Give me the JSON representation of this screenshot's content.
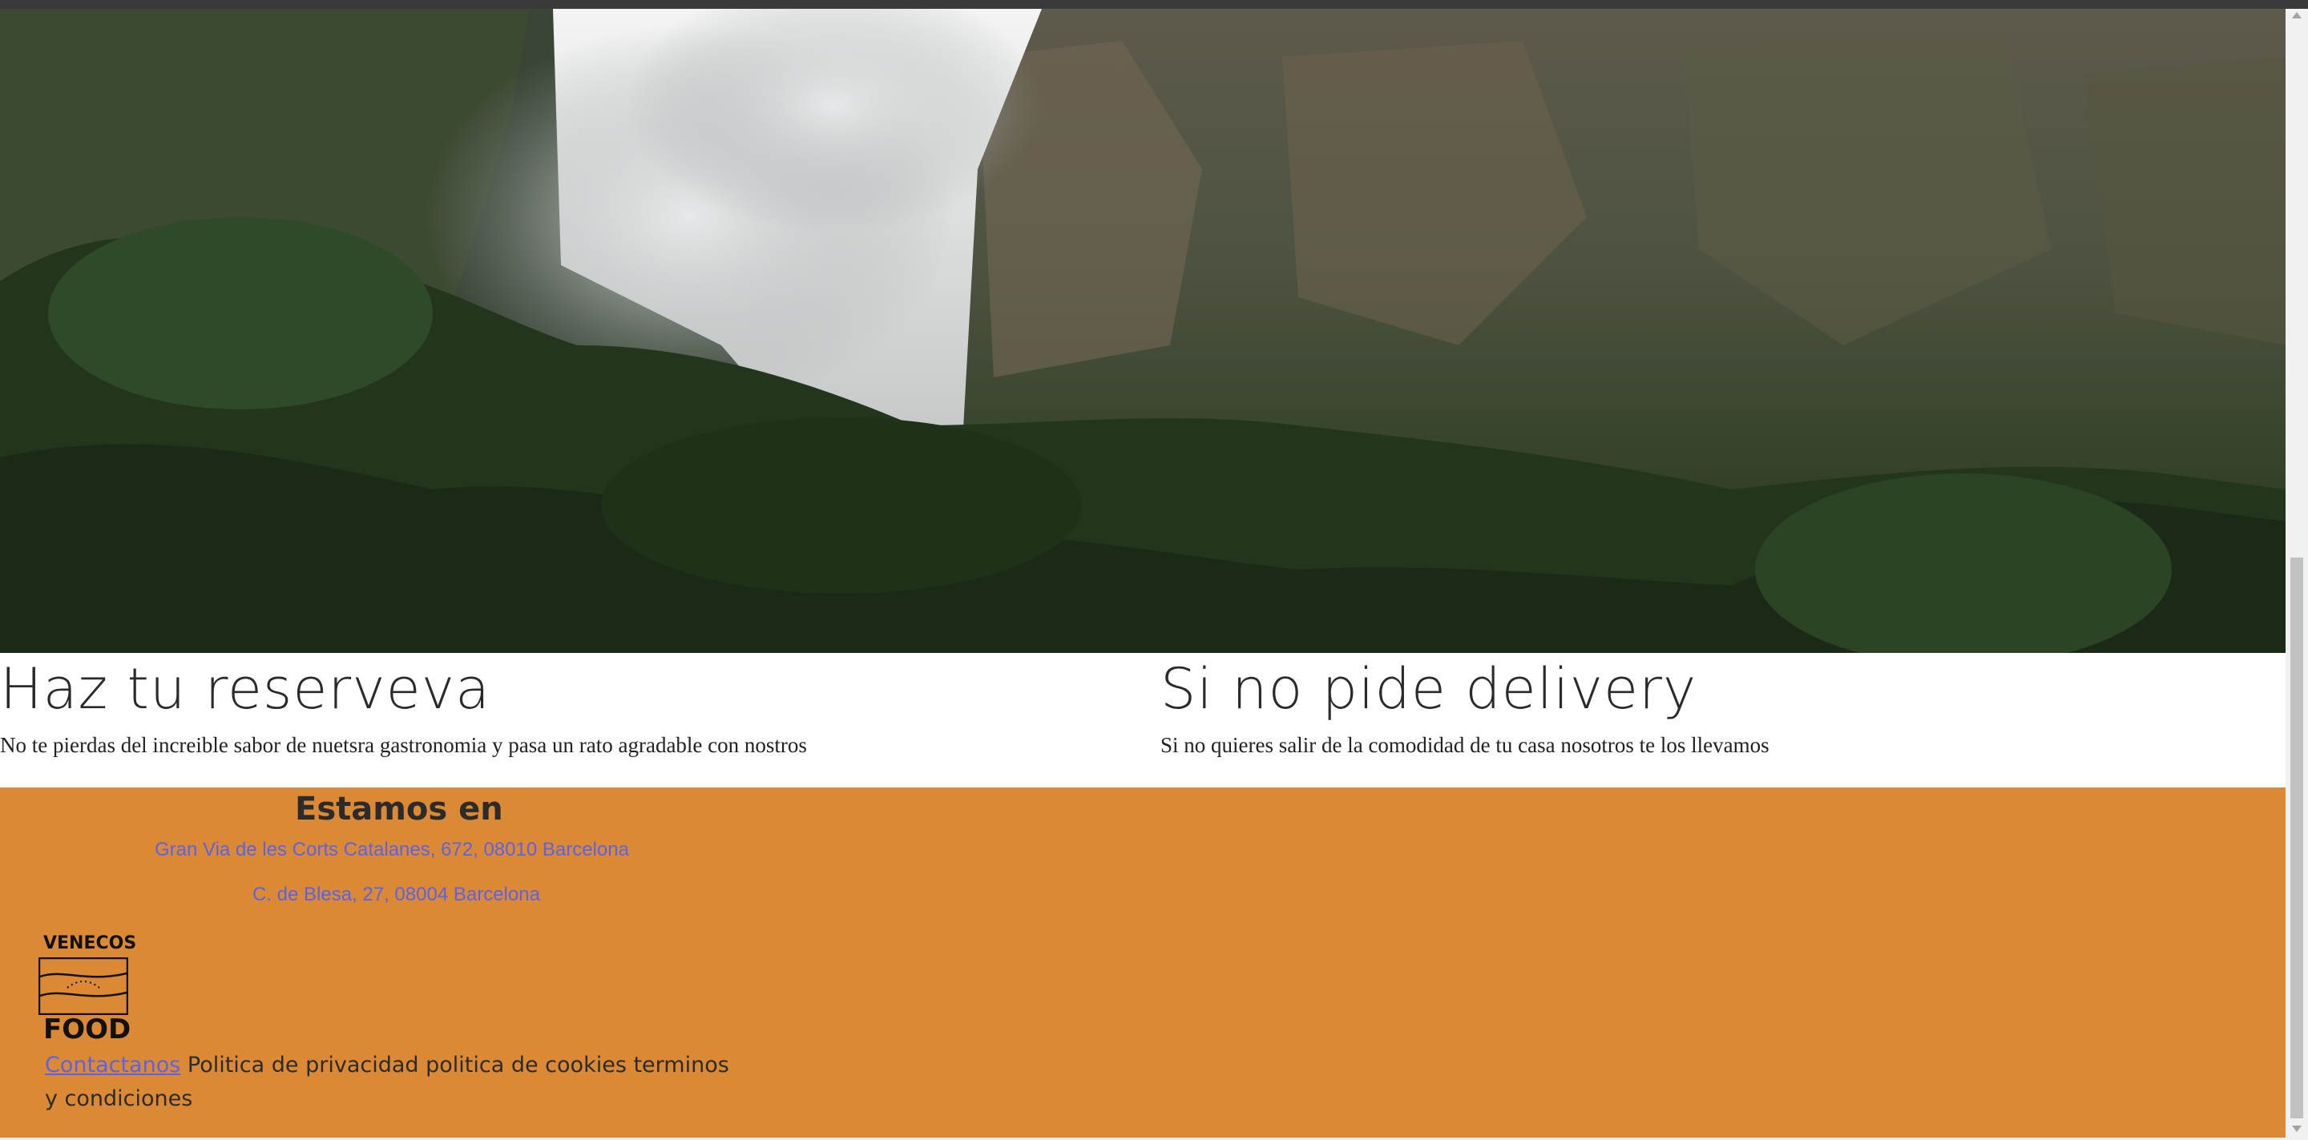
{
  "hero": {
    "image_description_icon": "waterfall-landscape-image"
  },
  "sections": {
    "reserva": {
      "title": "Haz tu reserveva",
      "text": "No te pierdas del increible sabor de nuetsra gastronomia y pasa un rato agradable con nostros"
    },
    "delivery": {
      "title": "Si no pide delivery",
      "text": "Si no quieres salir de la comodidad de tu casa nosotros te los llevamos"
    }
  },
  "footer": {
    "estamos_title": "Estamos en",
    "addresses": [
      "Gran Via de les Corts Catalanes, 672, 08010 Barcelona",
      "C. de Blesa, 27, 08004 Barcelona"
    ],
    "logo": {
      "top_text": "VENECOS",
      "bottom_text": "FOOD"
    },
    "links": {
      "contact": "Contactanos",
      "rest": " Politica de privacidad politica de cookies terminos y condiciones"
    },
    "background_color": "#dc8936",
    "link_color": "#5a63e8"
  }
}
